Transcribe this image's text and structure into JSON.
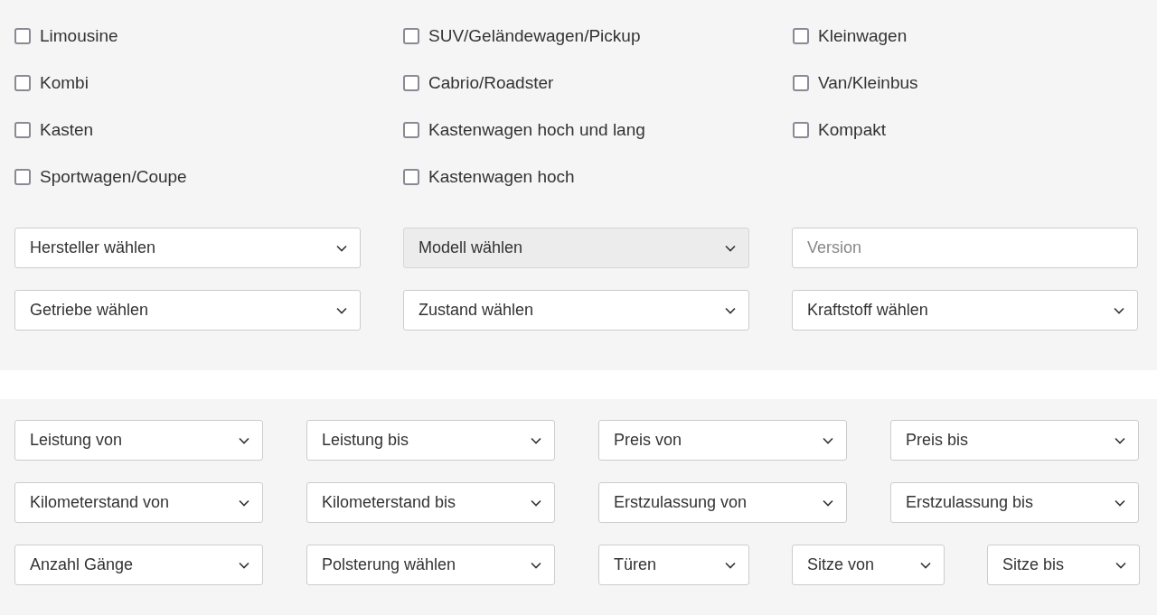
{
  "body_types": [
    {
      "label": "Limousine",
      "checked": false
    },
    {
      "label": "SUV/Geländewagen/Pickup",
      "checked": false
    },
    {
      "label": "Kleinwagen",
      "checked": false
    },
    {
      "label": "Kombi",
      "checked": false
    },
    {
      "label": "Cabrio/Roadster",
      "checked": false
    },
    {
      "label": "Van/Kleinbus",
      "checked": false
    },
    {
      "label": "Kasten",
      "checked": false
    },
    {
      "label": "Kastenwagen hoch und lang",
      "checked": false
    },
    {
      "label": "Kompakt",
      "checked": false
    },
    {
      "label": "Sportwagen/Coupe",
      "checked": false
    },
    {
      "label": "Kastenwagen hoch",
      "checked": false
    }
  ],
  "main_filters": [
    {
      "kind": "select",
      "label": "Hersteller wählen",
      "disabled": false
    },
    {
      "kind": "select",
      "label": "Modell wählen",
      "disabled": true
    },
    {
      "kind": "input",
      "placeholder": "Version"
    },
    {
      "kind": "select",
      "label": "Getriebe wählen",
      "disabled": false
    },
    {
      "kind": "select",
      "label": "Zustand wählen",
      "disabled": false
    },
    {
      "kind": "select",
      "label": "Kraftstoff wählen",
      "disabled": false
    }
  ],
  "range_filters": [
    [
      {
        "label": "Leistung von"
      },
      {
        "label": "Leistung bis"
      },
      {
        "label": "Preis von"
      },
      {
        "label": "Preis bis"
      }
    ],
    [
      {
        "label": "Kilometerstand von"
      },
      {
        "label": "Kilometerstand bis"
      },
      {
        "label": "Erstzulassung von"
      },
      {
        "label": "Erstzulassung bis"
      }
    ],
    [
      {
        "label": "Anzahl Gänge"
      },
      {
        "label": "Polsterung wählen"
      },
      {
        "label": "Türen"
      },
      {
        "label": "Sitze von"
      },
      {
        "label": "Sitze bis"
      }
    ]
  ]
}
